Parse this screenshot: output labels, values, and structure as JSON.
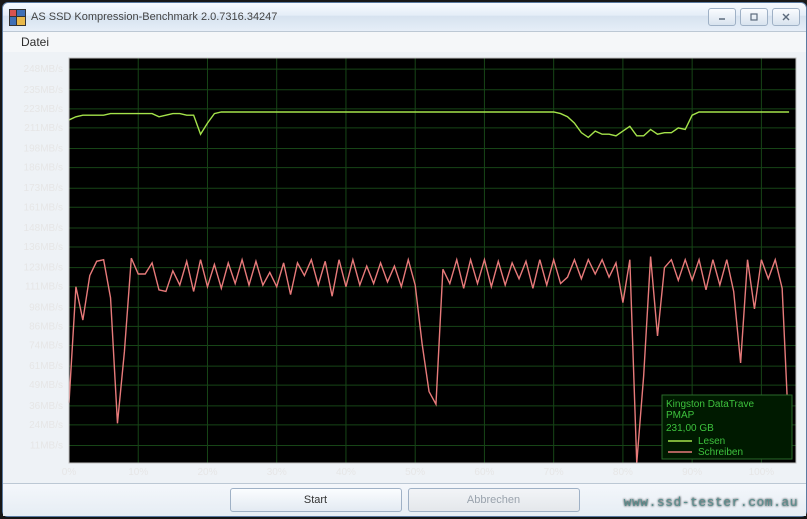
{
  "window": {
    "title": "AS SSD Kompression-Benchmark 2.0.7316.34247"
  },
  "menu": {
    "datei": "Datei"
  },
  "buttons": {
    "start": "Start",
    "cancel": "Abbrechen"
  },
  "watermark": "www.ssd-tester.com.au",
  "legend": {
    "device": "Kingston DataTrave",
    "mode": "PMAP",
    "capacity": "231,00 GB",
    "read": "Lesen",
    "write": "Schreiben"
  },
  "chart_data": {
    "type": "line",
    "title": "",
    "xlabel": "",
    "ylabel": "",
    "xlim": [
      0,
      105
    ],
    "ylim": [
      0,
      255
    ],
    "y_ticks": [
      11,
      24,
      36,
      49,
      61,
      74,
      86,
      98,
      111,
      123,
      136,
      148,
      161,
      173,
      186,
      198,
      211,
      223,
      235,
      248
    ],
    "y_tick_suffix": "MB/s",
    "x_ticks": [
      0,
      10,
      20,
      30,
      40,
      50,
      60,
      70,
      80,
      90,
      100
    ],
    "x_tick_suffix": "%",
    "x": [
      0,
      1,
      2,
      3,
      4,
      5,
      6,
      7,
      8,
      9,
      10,
      11,
      12,
      13,
      14,
      15,
      16,
      17,
      18,
      19,
      20,
      21,
      22,
      23,
      24,
      25,
      26,
      27,
      28,
      29,
      30,
      31,
      32,
      33,
      34,
      35,
      36,
      37,
      38,
      39,
      40,
      41,
      42,
      43,
      44,
      45,
      46,
      47,
      48,
      49,
      50,
      51,
      52,
      53,
      54,
      55,
      56,
      57,
      58,
      59,
      60,
      61,
      62,
      63,
      64,
      65,
      66,
      67,
      68,
      69,
      70,
      71,
      72,
      73,
      74,
      75,
      76,
      77,
      78,
      79,
      80,
      81,
      82,
      83,
      84,
      85,
      86,
      87,
      88,
      89,
      90,
      91,
      92,
      93,
      94,
      95,
      96,
      97,
      98,
      99,
      100,
      101,
      102,
      103,
      104
    ],
    "series": [
      {
        "name": "Lesen",
        "color": "#a4e24a",
        "values": [
          216,
          218,
          219,
          219,
          219,
          219,
          220,
          220,
          220,
          220,
          220,
          220,
          220,
          218,
          219,
          220,
          220,
          219,
          219,
          207,
          214,
          220,
          221,
          221,
          221,
          221,
          221,
          221,
          221,
          221,
          221,
          221,
          221,
          221,
          221,
          221,
          221,
          221,
          221,
          221,
          221,
          221,
          221,
          221,
          221,
          221,
          221,
          221,
          221,
          221,
          221,
          221,
          221,
          221,
          221,
          221,
          221,
          221,
          221,
          221,
          221,
          221,
          221,
          221,
          221,
          221,
          221,
          221,
          221,
          221,
          221,
          220,
          218,
          214,
          208,
          205,
          209,
          207,
          207,
          206,
          209,
          212,
          206,
          206,
          210,
          207,
          208,
          208,
          211,
          210,
          219,
          221,
          221,
          221,
          221,
          221,
          221,
          221,
          221,
          221,
          221,
          221,
          221,
          221,
          221
        ]
      },
      {
        "name": "Schreiben",
        "color": "#e87a7a",
        "values": [
          38,
          111,
          90,
          118,
          127,
          128,
          104,
          25,
          70,
          129,
          119,
          119,
          126,
          109,
          108,
          121,
          112,
          127,
          108,
          128,
          111,
          125,
          110,
          126,
          113,
          128,
          112,
          127,
          112,
          120,
          111,
          126,
          106,
          126,
          118,
          128,
          112,
          127,
          105,
          128,
          111,
          128,
          112,
          124,
          113,
          126,
          114,
          124,
          111,
          128,
          112,
          75,
          45,
          37,
          122,
          113,
          128,
          110,
          128,
          113,
          128,
          111,
          127,
          112,
          126,
          116,
          127,
          110,
          128,
          112,
          128,
          113,
          117,
          128,
          116,
          128,
          119,
          128,
          117,
          126,
          101,
          128,
          0,
          55,
          130,
          80,
          123,
          128,
          115,
          128,
          115,
          128,
          109,
          128,
          112,
          128,
          108,
          63,
          128,
          97,
          128,
          116,
          128,
          110,
          15
        ]
      }
    ]
  }
}
